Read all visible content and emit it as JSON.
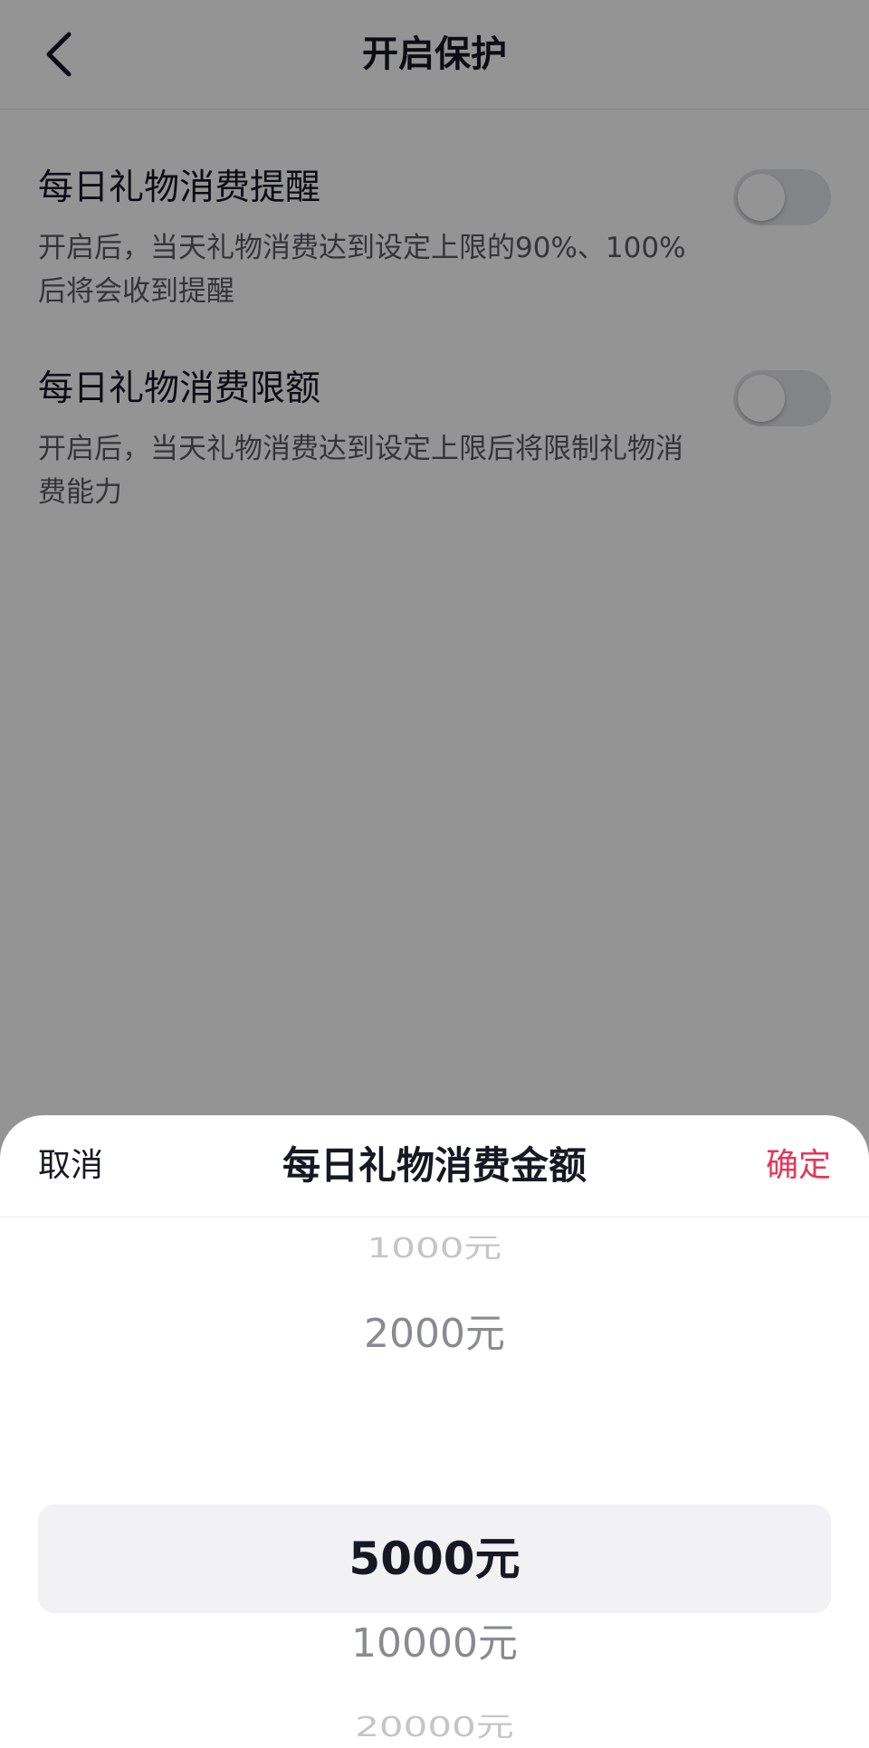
{
  "header": {
    "title": "开启保护",
    "back_icon": "chevron-left-icon"
  },
  "settings": [
    {
      "title": "每日礼物消费提醒",
      "description": "开启后，当天礼物消费达到设定上限的90%、100%后将会收到提醒",
      "enabled": false
    },
    {
      "title": "每日礼物消费限额",
      "description": "开启后，当天礼物消费达到设定上限后将限制礼物消费能力",
      "enabled": false
    }
  ],
  "sheet": {
    "cancel_label": "取消",
    "title": "每日礼物消费金额",
    "confirm_label": "确定",
    "options": [
      "1000元",
      "2000元",
      "5000元",
      "10000元",
      "20000元"
    ],
    "selected": "5000元"
  },
  "colors": {
    "accent": "#e4375b",
    "text_primary": "#161823",
    "text_secondary": "#5b5c63",
    "overlay": "rgba(0,0,0,0.42)",
    "highlight": "#f2f2f4"
  }
}
